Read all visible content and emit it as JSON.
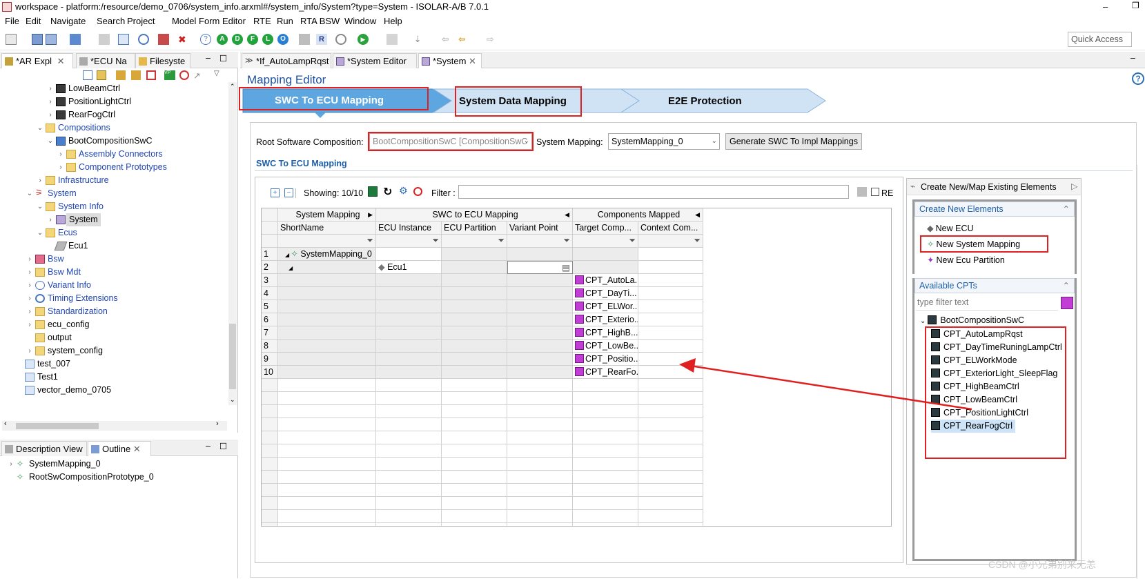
{
  "window": {
    "title": "workspace - platform:/resource/demo_0706/system_info.arxml#/system_info/System?type=System - ISOLAR-A/B 7.0.1"
  },
  "menu": [
    "File",
    "Edit",
    "Navigate",
    "Search",
    "Project",
    "Model Form Editor",
    "RTE",
    "Run",
    "RTA BSW",
    "Window",
    "Help"
  ],
  "toolbar": {
    "quick_access": "Quick Access",
    "circle_icons": [
      "A",
      "D",
      "F",
      "L",
      "O"
    ]
  },
  "left_tabs": [
    "*AR Expl",
    "*ECU Na",
    "Filesyste"
  ],
  "tree": [
    {
      "label": "LowBeamCtrl",
      "depth": 3,
      "arrow": "›",
      "icon": "component",
      "link": false
    },
    {
      "label": "PositionLightCtrl",
      "depth": 3,
      "arrow": "›",
      "icon": "component",
      "link": false
    },
    {
      "label": "RearFogCtrl",
      "depth": 3,
      "arrow": "›",
      "icon": "component",
      "link": false
    },
    {
      "label": "Compositions",
      "depth": 2,
      "arrow": "⌄",
      "icon": "folder",
      "link": true
    },
    {
      "label": "BootCompositionSwC",
      "depth": 3,
      "arrow": "⌄",
      "icon": "composition",
      "link": false
    },
    {
      "label": "Assembly Connectors",
      "depth": 4,
      "arrow": "›",
      "icon": "folder",
      "link": true
    },
    {
      "label": "Component Prototypes",
      "depth": 4,
      "arrow": "›",
      "icon": "folder",
      "link": true
    },
    {
      "label": "Infrastructure",
      "depth": 2,
      "arrow": "›",
      "icon": "folder",
      "link": true
    },
    {
      "label": "System",
      "depth": 1,
      "arrow": "⌄",
      "icon": "system",
      "link": true
    },
    {
      "label": "System Info",
      "depth": 2,
      "arrow": "⌄",
      "icon": "folder",
      "link": true
    },
    {
      "label": "System",
      "depth": 3,
      "arrow": "›",
      "icon": "system-doc",
      "link": false,
      "selected": true
    },
    {
      "label": "Ecus",
      "depth": 2,
      "arrow": "⌄",
      "icon": "folder",
      "link": true
    },
    {
      "label": "Ecu1",
      "depth": 3,
      "arrow": "",
      "icon": "ecu",
      "link": false
    },
    {
      "label": "Bsw",
      "depth": 1,
      "arrow": "›",
      "icon": "bsw",
      "link": true
    },
    {
      "label": "Bsw Mdt",
      "depth": 1,
      "arrow": "›",
      "icon": "folder",
      "link": true
    },
    {
      "label": "Variant Info",
      "depth": 1,
      "arrow": "›",
      "icon": "variant",
      "link": true
    },
    {
      "label": "Timing Extensions",
      "depth": 1,
      "arrow": "›",
      "icon": "clock",
      "link": true
    },
    {
      "label": "Standardization",
      "depth": 1,
      "arrow": "›",
      "icon": "folder",
      "link": true
    },
    {
      "label": "ecu_config",
      "depth": 1,
      "arrow": "›",
      "icon": "folder",
      "link": false
    },
    {
      "label": "output",
      "depth": 1,
      "arrow": "",
      "icon": "folder",
      "link": false
    },
    {
      "label": "system_config",
      "depth": 1,
      "arrow": "›",
      "icon": "folder",
      "link": false
    },
    {
      "label": "test_007",
      "depth": 0,
      "arrow": "",
      "icon": "project",
      "link": false
    },
    {
      "label": "Test1",
      "depth": 0,
      "arrow": "",
      "icon": "project",
      "link": false
    },
    {
      "label": "vector_demo_0705",
      "depth": 0,
      "arrow": "",
      "icon": "project",
      "link": false
    }
  ],
  "outline": {
    "tabs": [
      "Description View",
      "Outline"
    ],
    "items": [
      "SystemMapping_0",
      "RootSwCompositionPrototype_0"
    ]
  },
  "editor_tabs": [
    "*If_AutoLampRqst",
    "*System Editor",
    "*System"
  ],
  "editor": {
    "title": "Mapping Editor",
    "steps": [
      "SWC To ECU Mapping",
      "System Data Mapping",
      "E2E Protection"
    ],
    "root_label": "Root Software Composition:",
    "root_value": "BootCompositionSwC [CompositionSwC",
    "system_mapping_label": "System Mapping:",
    "system_mapping_value": "SystemMapping_0",
    "generate_button": "Generate SWC To Impl Mappings",
    "section_title": "SWC To ECU Mapping",
    "showing": "Showing: 10/10",
    "filter_label": "Filter :",
    "re_label": "RE",
    "groups": [
      "System Mapping",
      "SWC to ECU Mapping",
      "Components Mapped"
    ],
    "columns": [
      "ShortName",
      "ECU Instance",
      "ECU Partition",
      "Variant Point",
      "Target Comp...",
      "Context Com..."
    ],
    "rows": [
      {
        "n": "1",
        "short": "SystemMapping_0",
        "ecu": "",
        "target": ""
      },
      {
        "n": "2",
        "short": "",
        "ecu": "Ecu1",
        "target": ""
      },
      {
        "n": "3",
        "short": "",
        "ecu": "",
        "target": "CPT_AutoLa..."
      },
      {
        "n": "4",
        "short": "",
        "ecu": "",
        "target": "CPT_DayTi..."
      },
      {
        "n": "5",
        "short": "",
        "ecu": "",
        "target": "CPT_ELWor..."
      },
      {
        "n": "6",
        "short": "",
        "ecu": "",
        "target": "CPT_Exterio..."
      },
      {
        "n": "7",
        "short": "",
        "ecu": "",
        "target": "CPT_HighB..."
      },
      {
        "n": "8",
        "short": "",
        "ecu": "",
        "target": "CPT_LowBe..."
      },
      {
        "n": "9",
        "short": "",
        "ecu": "",
        "target": "CPT_Positio..."
      },
      {
        "n": "10",
        "short": "",
        "ecu": "",
        "target": "CPT_RearFo..."
      }
    ]
  },
  "right_panel": {
    "title": "Create New/Map Existing Elements",
    "create_header": "Create New Elements",
    "create_items": [
      "New ECU",
      "New System Mapping",
      "New Ecu Partition"
    ],
    "available_header": "Available CPTs",
    "filter_placeholder": "type filter text",
    "root": "BootCompositionSwC",
    "cpts": [
      "CPT_AutoLampRqst",
      "CPT_DayTimeRuningLampCtrl",
      "CPT_ELWorkMode",
      "CPT_ExteriorLight_SleepFlag",
      "CPT_HighBeamCtrl",
      "CPT_LowBeamCtrl",
      "CPT_PositionLightCtrl",
      "CPT_RearFogCtrl"
    ],
    "selected_cpt": "CPT_RearFogCtrl"
  },
  "watermark": "CSDN @小兄弟别来无恙",
  "colors": {
    "accent_blue": "#5ea6e0",
    "highlight_red": "#e02020",
    "link_blue": "#2046b5",
    "cpt_purple": "#c23cd6"
  }
}
